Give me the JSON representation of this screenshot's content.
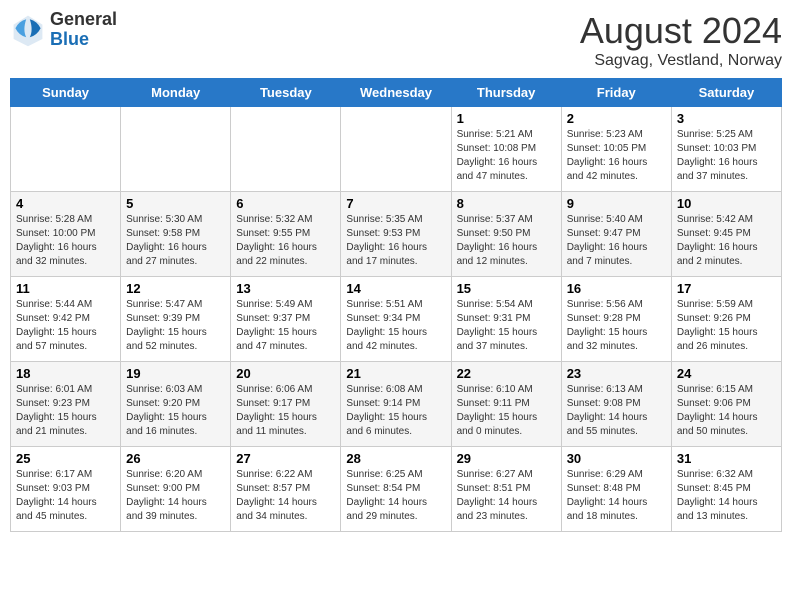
{
  "header": {
    "logo_general": "General",
    "logo_blue": "Blue",
    "month_title": "August 2024",
    "subtitle": "Sagvag, Vestland, Norway"
  },
  "weekdays": [
    "Sunday",
    "Monday",
    "Tuesday",
    "Wednesday",
    "Thursday",
    "Friday",
    "Saturday"
  ],
  "weeks": [
    [
      {
        "day": "",
        "info": ""
      },
      {
        "day": "",
        "info": ""
      },
      {
        "day": "",
        "info": ""
      },
      {
        "day": "",
        "info": ""
      },
      {
        "day": "1",
        "info": "Sunrise: 5:21 AM\nSunset: 10:08 PM\nDaylight: 16 hours\nand 47 minutes."
      },
      {
        "day": "2",
        "info": "Sunrise: 5:23 AM\nSunset: 10:05 PM\nDaylight: 16 hours\nand 42 minutes."
      },
      {
        "day": "3",
        "info": "Sunrise: 5:25 AM\nSunset: 10:03 PM\nDaylight: 16 hours\nand 37 minutes."
      }
    ],
    [
      {
        "day": "4",
        "info": "Sunrise: 5:28 AM\nSunset: 10:00 PM\nDaylight: 16 hours\nand 32 minutes."
      },
      {
        "day": "5",
        "info": "Sunrise: 5:30 AM\nSunset: 9:58 PM\nDaylight: 16 hours\nand 27 minutes."
      },
      {
        "day": "6",
        "info": "Sunrise: 5:32 AM\nSunset: 9:55 PM\nDaylight: 16 hours\nand 22 minutes."
      },
      {
        "day": "7",
        "info": "Sunrise: 5:35 AM\nSunset: 9:53 PM\nDaylight: 16 hours\nand 17 minutes."
      },
      {
        "day": "8",
        "info": "Sunrise: 5:37 AM\nSunset: 9:50 PM\nDaylight: 16 hours\nand 12 minutes."
      },
      {
        "day": "9",
        "info": "Sunrise: 5:40 AM\nSunset: 9:47 PM\nDaylight: 16 hours\nand 7 minutes."
      },
      {
        "day": "10",
        "info": "Sunrise: 5:42 AM\nSunset: 9:45 PM\nDaylight: 16 hours\nand 2 minutes."
      }
    ],
    [
      {
        "day": "11",
        "info": "Sunrise: 5:44 AM\nSunset: 9:42 PM\nDaylight: 15 hours\nand 57 minutes."
      },
      {
        "day": "12",
        "info": "Sunrise: 5:47 AM\nSunset: 9:39 PM\nDaylight: 15 hours\nand 52 minutes."
      },
      {
        "day": "13",
        "info": "Sunrise: 5:49 AM\nSunset: 9:37 PM\nDaylight: 15 hours\nand 47 minutes."
      },
      {
        "day": "14",
        "info": "Sunrise: 5:51 AM\nSunset: 9:34 PM\nDaylight: 15 hours\nand 42 minutes."
      },
      {
        "day": "15",
        "info": "Sunrise: 5:54 AM\nSunset: 9:31 PM\nDaylight: 15 hours\nand 37 minutes."
      },
      {
        "day": "16",
        "info": "Sunrise: 5:56 AM\nSunset: 9:28 PM\nDaylight: 15 hours\nand 32 minutes."
      },
      {
        "day": "17",
        "info": "Sunrise: 5:59 AM\nSunset: 9:26 PM\nDaylight: 15 hours\nand 26 minutes."
      }
    ],
    [
      {
        "day": "18",
        "info": "Sunrise: 6:01 AM\nSunset: 9:23 PM\nDaylight: 15 hours\nand 21 minutes."
      },
      {
        "day": "19",
        "info": "Sunrise: 6:03 AM\nSunset: 9:20 PM\nDaylight: 15 hours\nand 16 minutes."
      },
      {
        "day": "20",
        "info": "Sunrise: 6:06 AM\nSunset: 9:17 PM\nDaylight: 15 hours\nand 11 minutes."
      },
      {
        "day": "21",
        "info": "Sunrise: 6:08 AM\nSunset: 9:14 PM\nDaylight: 15 hours\nand 6 minutes."
      },
      {
        "day": "22",
        "info": "Sunrise: 6:10 AM\nSunset: 9:11 PM\nDaylight: 15 hours\nand 0 minutes."
      },
      {
        "day": "23",
        "info": "Sunrise: 6:13 AM\nSunset: 9:08 PM\nDaylight: 14 hours\nand 55 minutes."
      },
      {
        "day": "24",
        "info": "Sunrise: 6:15 AM\nSunset: 9:06 PM\nDaylight: 14 hours\nand 50 minutes."
      }
    ],
    [
      {
        "day": "25",
        "info": "Sunrise: 6:17 AM\nSunset: 9:03 PM\nDaylight: 14 hours\nand 45 minutes."
      },
      {
        "day": "26",
        "info": "Sunrise: 6:20 AM\nSunset: 9:00 PM\nDaylight: 14 hours\nand 39 minutes."
      },
      {
        "day": "27",
        "info": "Sunrise: 6:22 AM\nSunset: 8:57 PM\nDaylight: 14 hours\nand 34 minutes."
      },
      {
        "day": "28",
        "info": "Sunrise: 6:25 AM\nSunset: 8:54 PM\nDaylight: 14 hours\nand 29 minutes."
      },
      {
        "day": "29",
        "info": "Sunrise: 6:27 AM\nSunset: 8:51 PM\nDaylight: 14 hours\nand 23 minutes."
      },
      {
        "day": "30",
        "info": "Sunrise: 6:29 AM\nSunset: 8:48 PM\nDaylight: 14 hours\nand 18 minutes."
      },
      {
        "day": "31",
        "info": "Sunrise: 6:32 AM\nSunset: 8:45 PM\nDaylight: 14 hours\nand 13 minutes."
      }
    ]
  ]
}
